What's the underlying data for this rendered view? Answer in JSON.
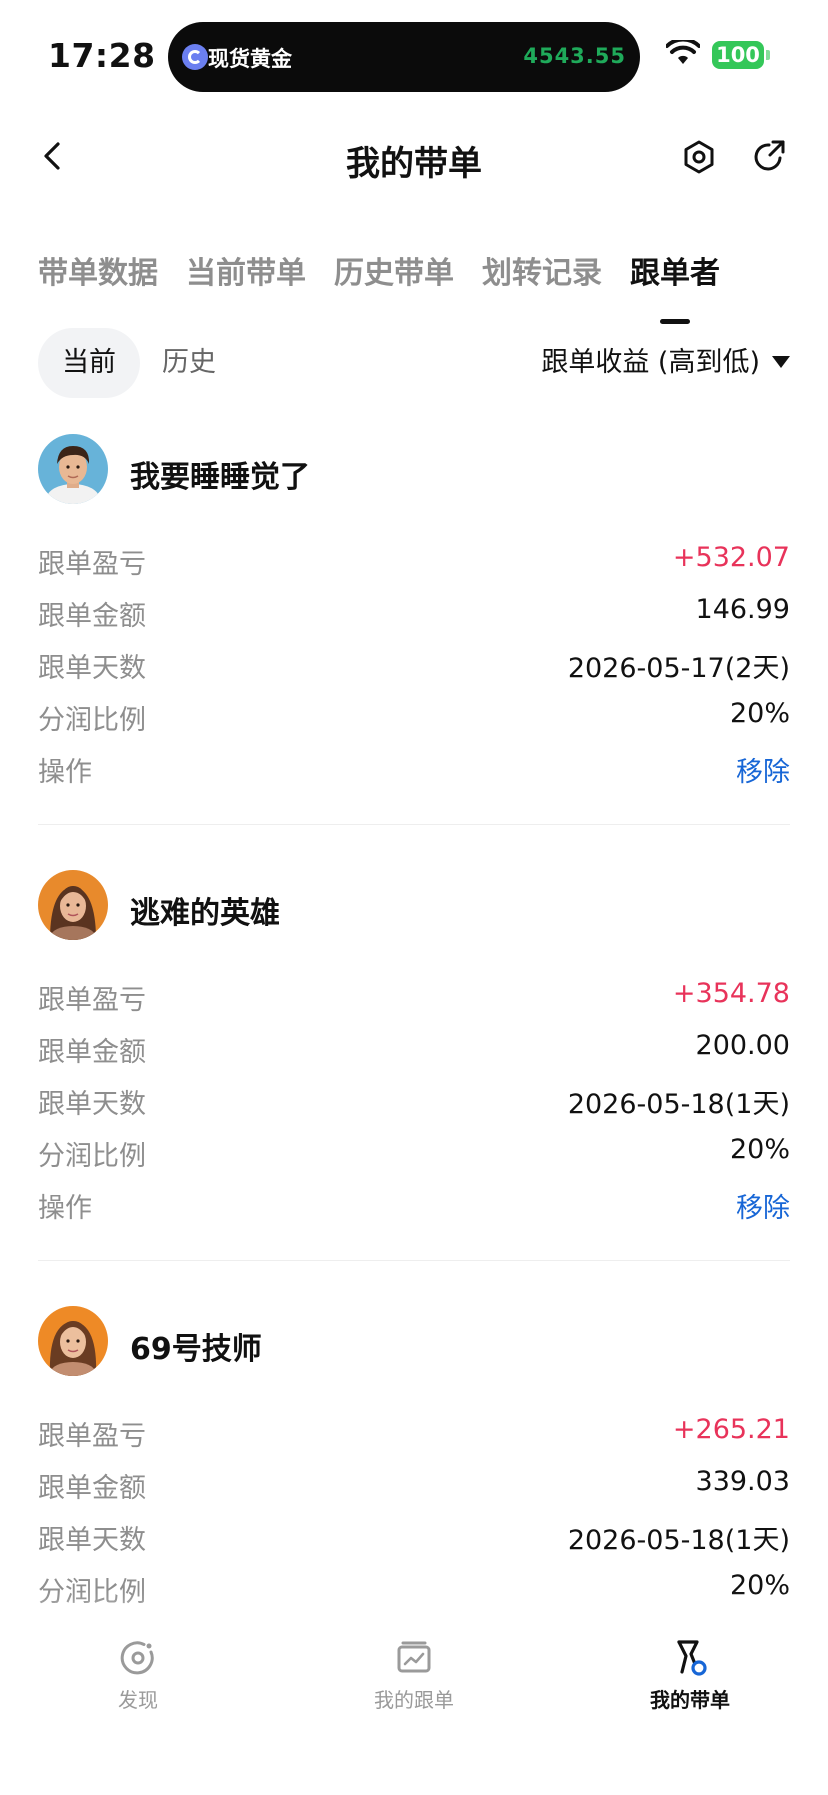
{
  "status_bar": {
    "time": "17:28",
    "island_label": "现货黄金",
    "island_price": "4543.55",
    "battery": "100"
  },
  "nav": {
    "title": "我的带单"
  },
  "tabs": [
    {
      "label": "带单数据"
    },
    {
      "label": "当前带单"
    },
    {
      "label": "历史带单"
    },
    {
      "label": "划转记录"
    },
    {
      "label": "跟单者"
    }
  ],
  "filter": {
    "current": "当前",
    "history": "历史",
    "sort": "跟单收益 (高到低)"
  },
  "row_labels": {
    "pnl": "跟单盈亏",
    "amount": "跟单金额",
    "days": "跟单天数",
    "share": "分润比例",
    "action": "操作"
  },
  "followers": [
    {
      "name": "我要睡睡觉了",
      "pnl": "+532.07",
      "amount": "146.99",
      "days": "2026-05-17(2天)",
      "share": "20%",
      "action": "移除"
    },
    {
      "name": "逃难的英雄",
      "pnl": "+354.78",
      "amount": "200.00",
      "days": "2026-05-18(1天)",
      "share": "20%",
      "action": "移除"
    },
    {
      "name": "69号技师",
      "pnl": "+265.21",
      "amount": "339.03",
      "days": "2026-05-18(1天)",
      "share": "20%"
    }
  ],
  "bottom_nav": [
    {
      "label": "发现"
    },
    {
      "label": "我的跟单"
    },
    {
      "label": "我的带单"
    }
  ],
  "colors": {
    "profit": "#e8335a",
    "link": "#1766d6",
    "gold_price": "#1faa5a",
    "battery": "#34c759"
  }
}
